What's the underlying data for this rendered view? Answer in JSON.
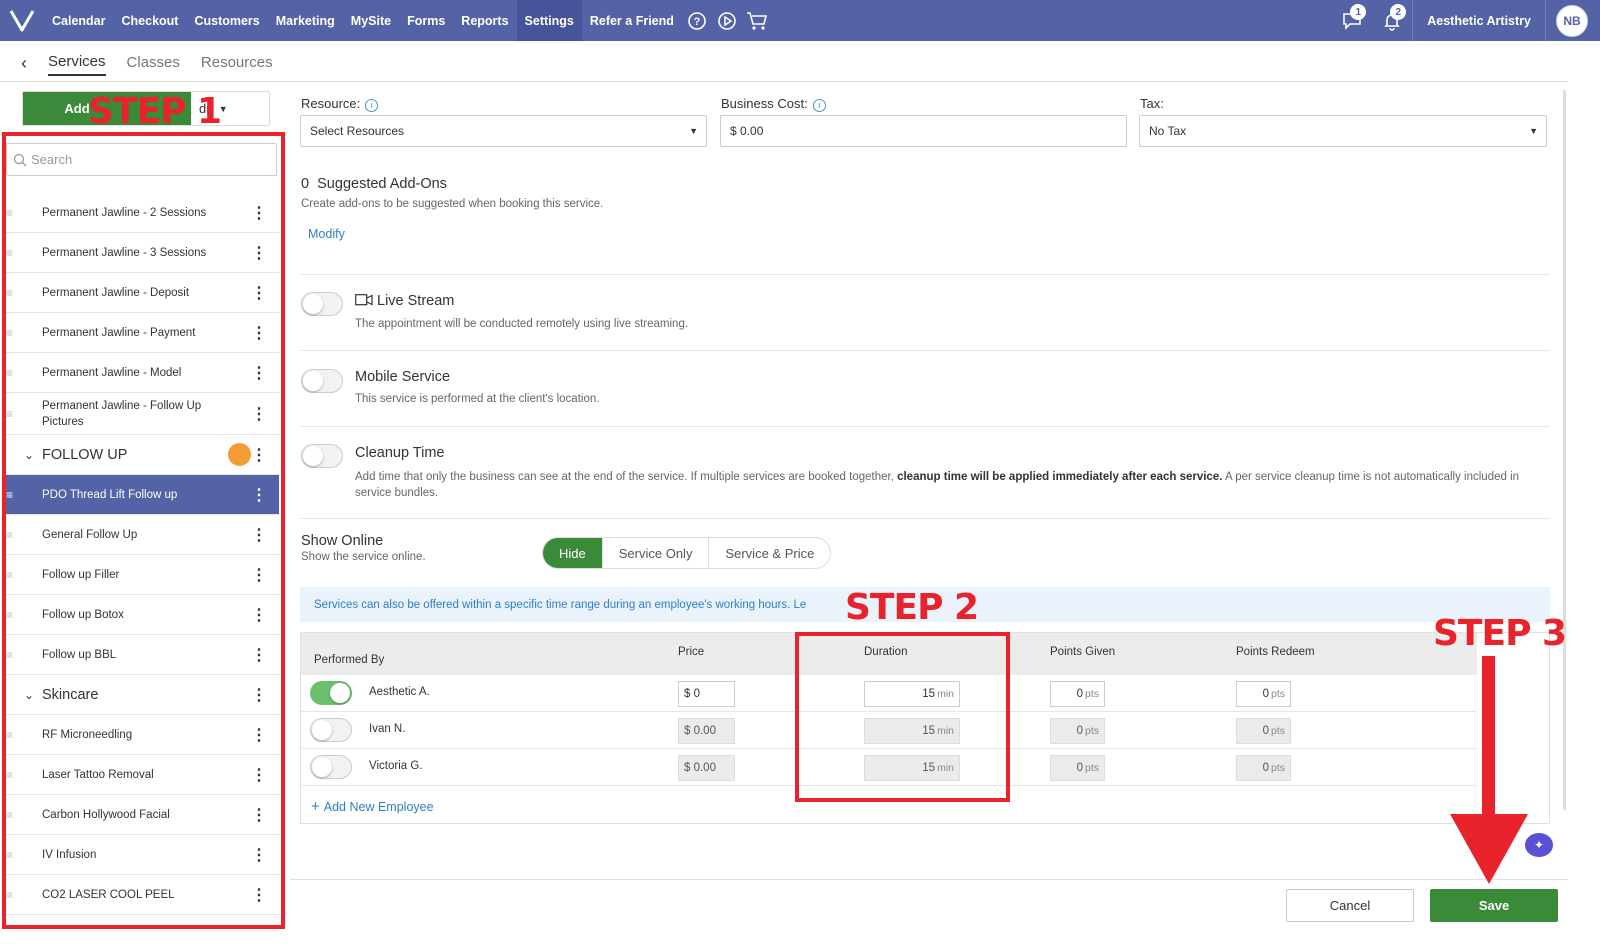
{
  "nav": {
    "items": [
      "Calendar",
      "Checkout",
      "Customers",
      "Marketing",
      "MySite",
      "Forms",
      "Reports",
      "Settings",
      "Refer a Friend"
    ],
    "active": "Settings",
    "messages_badge": "1",
    "notifications_badge": "2",
    "business_name": "Aesthetic Artistry",
    "avatar_initials": "NB"
  },
  "subtabs": [
    "Services",
    "Classes",
    "Resources"
  ],
  "left": {
    "add_label": "Add",
    "edit_label": "dit",
    "search_placeholder": "Search",
    "items": [
      {
        "label": "Permanent Jawline - 2 Sessions",
        "type": "service"
      },
      {
        "label": "Permanent Jawline - 3 Sessions",
        "type": "service"
      },
      {
        "label": "Permanent Jawline - Deposit",
        "type": "service"
      },
      {
        "label": "Permanent Jawline - Payment",
        "type": "service"
      },
      {
        "label": "Permanent Jawline - Model",
        "type": "service"
      },
      {
        "label": "Permanent Jawline - Follow Up Pictures",
        "type": "service"
      },
      {
        "label": "FOLLOW UP",
        "type": "category"
      },
      {
        "label": "PDO Thread Lift Follow up",
        "type": "service",
        "selected": true
      },
      {
        "label": "General Follow Up",
        "type": "service"
      },
      {
        "label": "Follow up Filler",
        "type": "service"
      },
      {
        "label": "Follow up Botox",
        "type": "service"
      },
      {
        "label": "Follow up BBL",
        "type": "service"
      },
      {
        "label": "Skincare",
        "type": "category"
      },
      {
        "label": "RF Microneedling",
        "type": "service"
      },
      {
        "label": "Laser Tattoo Removal",
        "type": "service"
      },
      {
        "label": "Carbon Hollywood Facial",
        "type": "service"
      },
      {
        "label": "IV Infusion",
        "type": "service"
      },
      {
        "label": "CO2 LASER COOL PEEL",
        "type": "service"
      }
    ]
  },
  "annotations": {
    "step1": "STEP 1",
    "step2": "STEP 2",
    "step3": "STEP 3"
  },
  "form": {
    "resource_label": "Resource:",
    "resource_value": "Select Resources",
    "business_cost_label": "Business Cost:",
    "business_cost_value": "$ 0.00",
    "tax_label": "Tax:",
    "tax_value": "No Tax",
    "addons_count": "0",
    "addons_title": "Suggested Add-Ons",
    "addons_desc": "Create add-ons to be suggested when booking this service.",
    "modify_label": "Modify",
    "livestream_title": "Live Stream",
    "livestream_desc": "The appointment will be conducted remotely using live streaming.",
    "mobile_title": "Mobile Service",
    "mobile_desc": "This service is performed at the client's location.",
    "cleanup_title": "Cleanup Time",
    "cleanup_desc_1": "Add time that only the business can see at the end of the service. If multiple services are booked together, ",
    "cleanup_desc_bold": "cleanup time will be applied immediately after each service.",
    "cleanup_desc_2": " A per service cleanup time is not automatically included in service bundles.",
    "show_online_title": "Show Online",
    "show_online_desc": "Show the service online.",
    "show_online_options": [
      "Hide",
      "Service Only",
      "Service & Price"
    ],
    "show_online_selected": "Hide",
    "notice": "Services can also be offered within a specific time range during an employee's working hours. Le"
  },
  "employees": {
    "headers": [
      "Performed By",
      "Price",
      "Duration",
      "Points Given",
      "Points Redeem"
    ],
    "rows": [
      {
        "name": "Aesthetic A.",
        "enabled": true,
        "price": "$ 0",
        "duration": "15",
        "points_given": "0",
        "points_redeem": "0"
      },
      {
        "name": "Ivan N.",
        "enabled": false,
        "price": "$ 0.00",
        "duration": "15",
        "points_given": "0",
        "points_redeem": "0"
      },
      {
        "name": "Victoria G.",
        "enabled": false,
        "price": "$ 0.00",
        "duration": "15",
        "points_given": "0",
        "points_redeem": "0"
      }
    ],
    "duration_unit": "min",
    "points_unit": "pts",
    "add_label": "Add New Employee"
  },
  "footer": {
    "cancel_label": "Cancel",
    "save_label": "Save"
  },
  "colors": {
    "nav_bg": "#5462a6",
    "primary_green": "#3a8a3a",
    "annotation_red": "#e8232b",
    "link_blue": "#2d7dd2",
    "orange": "#f39c35"
  }
}
